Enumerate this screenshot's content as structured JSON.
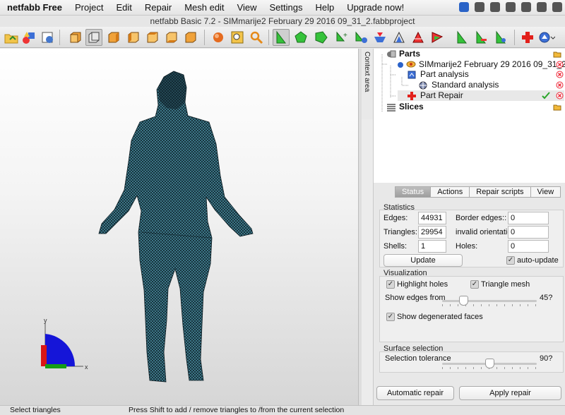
{
  "menubar": {
    "app": "netfabb Free",
    "items": [
      "Project",
      "Edit",
      "Repair",
      "Mesh edit",
      "View",
      "Settings",
      "Help",
      "Upgrade now!"
    ]
  },
  "window": {
    "title": "netfabb Basic 7.2 - SIMmarije2 February 29 2016 09_31_2.fabbproject"
  },
  "viewport": {
    "axis_x": "x",
    "axis_y": "y",
    "mesh_color": "#2f6b7e"
  },
  "context_tab": "Context area",
  "tree": {
    "parts_label": "Parts",
    "part_name": "SIMmarije2 February 29 2016 09_31_2",
    "part_analysis": "Part analysis",
    "standard_analysis": "Standard analysis",
    "part_repair": "Part Repair",
    "slices_label": "Slices"
  },
  "panel": {
    "tabs": [
      "Status",
      "Actions",
      "Repair scripts",
      "View"
    ],
    "statistics": {
      "title": "Statistics",
      "edges_label": "Edges:",
      "edges_value": "44931",
      "triangles_label": "Triangles:",
      "triangles_value": "29954",
      "shells_label": "Shells:",
      "shells_value": "1",
      "border_edges_label": "Border edges::",
      "border_edges_value": "0",
      "invalid_orientation_label": "invalid orientation",
      "invalid_orientation_value": "0",
      "holes_label": "Holes:",
      "holes_value": "0",
      "update_button": "Update",
      "auto_update_label": "auto-update"
    },
    "visualization": {
      "title": "Visualization",
      "highlight_holes_label": "Highlight holes",
      "triangle_mesh_label": "Triangle mesh",
      "show_edges_label": "Show edges from",
      "show_edges_value": "45?",
      "show_edges_fraction": 0.2,
      "degenerated_label": "Show degenerated faces"
    },
    "surface_selection": {
      "title": "Surface selection",
      "tolerance_label": "Selection tolerance",
      "tolerance_value": "90?",
      "tolerance_fraction": 0.5
    },
    "automatic_repair_button": "Automatic repair",
    "apply_repair_button": "Apply repair"
  },
  "statusbar": {
    "left": "Select triangles",
    "center": "Press Shift to add / remove triangles to /from the current selection"
  }
}
